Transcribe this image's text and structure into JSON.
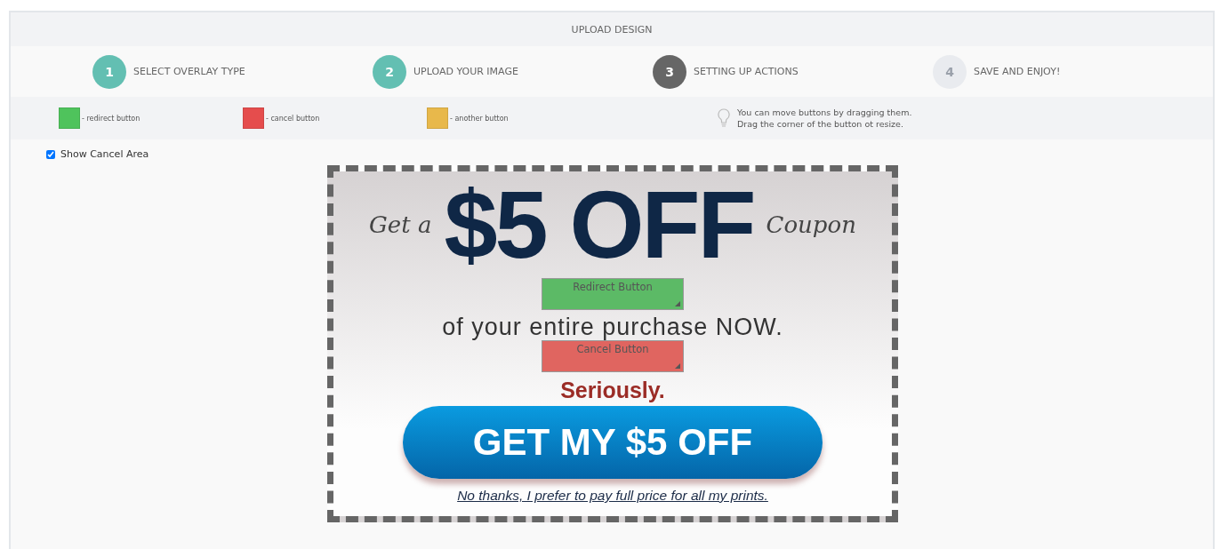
{
  "header": {
    "title": "UPLOAD DESIGN"
  },
  "steps": [
    {
      "number": "1",
      "label": "SELECT OVERLAY TYPE",
      "done": true,
      "current": false
    },
    {
      "number": "2",
      "label": "UPLOAD YOUR IMAGE",
      "done": true,
      "current": false
    },
    {
      "number": "3",
      "label": "SETTING UP ACTIONS",
      "done": false,
      "current": true
    },
    {
      "number": "4",
      "label": "SAVE AND ENJOY!",
      "done": false,
      "current": false
    }
  ],
  "legend": [
    {
      "label": "- redirect button",
      "color": "#4fc35c"
    },
    {
      "label": "- cancel button",
      "color": "#e54d4d"
    },
    {
      "label": "- another button",
      "color": "#e8b84b"
    }
  ],
  "tip": {
    "lines": [
      "You can move buttons by dragging them.",
      "Drag the corner of the button ot resize."
    ]
  },
  "show_cancel_area": {
    "label": "Show Cancel Area",
    "checked": true
  },
  "design": {
    "lead": "Get a",
    "headline": "$5 OFF",
    "trail": "Coupon",
    "subline": "of your entire purchase NOW.",
    "note": "Seriously.",
    "cta": "GET MY $5 OFF",
    "decline": "No thanks, I prefer to pay full price for all my prints."
  },
  "overlay_buttons": [
    {
      "kind": "redirect",
      "label": "Redirect Button",
      "color": "#5cba66"
    },
    {
      "kind": "cancel",
      "label": "Cancel Button",
      "color": "#e06560"
    }
  ]
}
